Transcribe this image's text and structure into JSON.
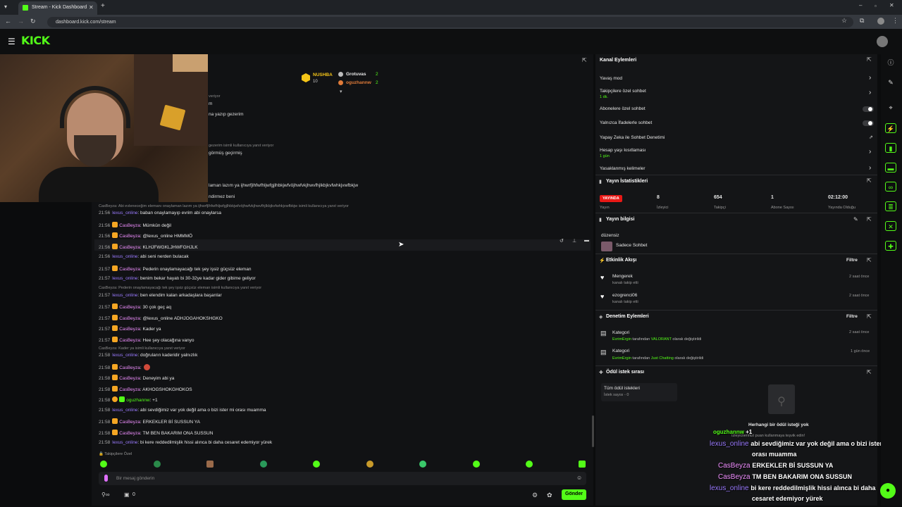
{
  "browser": {
    "tab_title": "Stream - Kick Dashboard",
    "url": "dashboard.kick.com/stream"
  },
  "kick": {
    "logo": "KICK"
  },
  "leaderboard": {
    "first_name": "NUSHBA",
    "first_score": "10",
    "second_name": "Grotuvas",
    "second_score": "2",
    "third_name": "oguzhannw",
    "third_score": "2"
  },
  "chat_fragments": [
    "veriyor",
    "m",
    "na yazıp gezerim",
    "gezerim isimli kullanıcıya yanıt veriyor",
    "görmüş geçirmiş",
    "laman lazım ya ijhwrfjlhfwfhljwfgjlhbkjwfvöjhwfvkjhwvfhjlkbjkvfwhkjvwfbkjw",
    "ndirmez beni"
  ],
  "chat": [
    {
      "reply": "CasBeyza: Abi evleneceğim elemanı onaylaman lazım ya ijhwrfjlhfwfhljwfgjlhbkjwfvöjhwfvkjhwvfhjlkbjkvfwhkjvwfbkjw isimli kullanıcıya yanıt veriyor"
    },
    {
      "time": "21:56",
      "user": "lexus_online",
      "cls": "uo",
      "text": ": baban onaylamayıp evrim abi onaylarsa"
    },
    {
      "time": "21:56",
      "user": "CasBeyza",
      "cls": "uc",
      "text": ": Mümkün değil"
    },
    {
      "time": "21:56",
      "user": "CasBeyza",
      "cls": "uc",
      "text": ": @lexus_online HMMMÖ"
    },
    {
      "time": "21:56",
      "user": "CasBeyza",
      "cls": "uc",
      "text": ": KLHJFWGKLJHWFGHJLK"
    },
    {
      "time": "21:56",
      "user": "lexus_online",
      "cls": "uo",
      "text": ": abi seni nerden bulacak"
    },
    {
      "time": "21:57",
      "user": "CasBeyza",
      "cls": "uc",
      "text": ": Pederin onaylamayacağı tek şey işsiz güçsüz eleman"
    },
    {
      "time": "21:57",
      "user": "lexus_online",
      "cls": "uo",
      "text": ": benim bekar hayatı bi 30-32ye kadar gider gibime geliyor"
    },
    {
      "reply": "CasBeyza: Pederin onaylamayacağı tek şey işsiz güçsüz eleman isimli kullanıcıya yanıt veriyor"
    },
    {
      "time": "21:57",
      "user": "lexus_online",
      "cls": "uo",
      "text": ": ben elendim kalan arkadaşlara başarılar"
    },
    {
      "time": "21:57",
      "user": "CasBeyza",
      "cls": "uc",
      "text": ": 30 çok geç aq"
    },
    {
      "time": "21:57",
      "user": "CasBeyza",
      "cls": "uc",
      "text": ": @lexus_online ADHJOGAHOKSHGKO"
    },
    {
      "time": "21:57",
      "user": "CasBeyza",
      "cls": "uc",
      "text": ": Kader ya"
    },
    {
      "time": "21:57",
      "user": "CasBeyza",
      "cls": "uc",
      "text": ": Hee şey olacağına vanyo"
    },
    {
      "reply": "CasBeyza: Kader ya isimli kullanıcıya yanıt veriyor"
    },
    {
      "time": "21:58",
      "user": "lexus_online",
      "cls": "uo",
      "text": ": doğruların kaderidir yalnızlık"
    },
    {
      "time": "21:58",
      "user": "CasBeyza",
      "cls": "uc",
      "text": ":"
    },
    {
      "time": "21:58",
      "user": "CasBeyza",
      "cls": "uc",
      "text": ": Deneyim abi ya"
    },
    {
      "time": "21:58",
      "user": "CasBeyza",
      "cls": "uc",
      "text": ": AKHOGSHOKGHOKOS"
    },
    {
      "time": "21:58",
      "user": "oguzhannw",
      "cls": "ug",
      "text": ": +1"
    },
    {
      "time": "21:58",
      "user": "lexus_online",
      "cls": "uo",
      "text": ": abi sevdiğimiz var yok değil ama o bizi ister mi orası muamma"
    },
    {
      "time": "21:58",
      "user": "CasBeyza",
      "cls": "uc",
      "text": ": ERKEKLER Bİ SUSSUN YA"
    },
    {
      "time": "21:58",
      "user": "CasBeyza",
      "cls": "uc",
      "text": ": TM BEN BAKARIM ONA SUSSUN"
    },
    {
      "time": "21:58",
      "user": "lexus_online",
      "cls": "uo",
      "text": ": bi kere reddedilmişlik hissi alınca bi daha cesaret edemiyor yürek"
    }
  ],
  "chat_footer": {
    "followers_only": "Takipçilere Özel",
    "input_placeholder": "Bir mesaj gönderin",
    "send_label": "Gönder",
    "points": "0"
  },
  "channel_actions": {
    "title": "Kanal Eylemleri",
    "slow_mode": "Yavaş mod",
    "followers_only": "Takipçilere özel sohbet",
    "followers_only_sub": "1 dk.",
    "subs_only": "Abonelere özel sohbet",
    "emotes_only": "Yalnızca İfadelerle sohbet",
    "ai_moderation": "Yapay Zeka ile Sohbet Denetimi",
    "age_restriction": "Hesap yaşı kısıtlaması",
    "age_restriction_sub": "1 gün",
    "banned_words": "Yasaklanmış kelimeler"
  },
  "stream_stats": {
    "title": "Yayın İstatistikleri",
    "live": "YAYINDA",
    "live_sub": "Yayın",
    "viewers": "8",
    "viewers_label": "İzleyici",
    "followers": "654",
    "followers_label": "Takipçi",
    "subs": "1",
    "subs_label": "Abone Sayısı",
    "uptime": "02:12:00",
    "uptime_label": "Yayında Olduğu"
  },
  "stream_info": {
    "title": "Yayın bilgisi",
    "stream_title": "düzensiz",
    "category": "Sadece Sohbet"
  },
  "activity": {
    "title": "Etkinlik Akışı",
    "filter": "Filtre",
    "items": [
      {
        "user": "Mengerek",
        "action": "kanalı takip etti",
        "time": "2 saat önce"
      },
      {
        "user": "ezogrenci06",
        "action": "kanalı takip etti",
        "time": "2 saat önce"
      }
    ]
  },
  "mod_actions": {
    "title": "Denetim Eylemleri",
    "filter": "Filtre",
    "items": [
      {
        "label": "Kategori",
        "by": "EvrimErgin",
        "mid": " tarafından ",
        "value": "VALORANT",
        "end": " olarak değiştirildi",
        "time": "2 saat önce"
      },
      {
        "label": "Kategori",
        "by": "EvrimErgin",
        "mid": " tarafından ",
        "value": "Just Chatting",
        "end": " olarak değiştirildi",
        "time": "1 gün önce"
      }
    ]
  },
  "rewards": {
    "title": "Ödül istek sırası",
    "all_requests": "Tüm ödül istekleri",
    "requests_count": "İstek sayısı - 0",
    "empty_title": "Herhangi bir ödül isteği yok",
    "empty_sub": "İzleyicilerinizi puan kullanmaya teşvik edin!"
  },
  "overlay_chat": [
    {
      "user": "oguzhannw",
      "text": "+1",
      "color": "#53fc18"
    },
    {
      "user": "lexus_online",
      "text": "abi sevdiğimiz var yok değil ama o bizi ister mi",
      "color": "#9b7bff"
    },
    {
      "user": "",
      "text": "orası muamma",
      "color": "#9b7bff"
    },
    {
      "user": "CasBeyza",
      "text": "ERKEKLER Bİ SUSSUN YA",
      "color": "#f08fff"
    },
    {
      "user": "CasBeyza",
      "text": "TM BEN BAKARIM ONA SUSSUN",
      "color": "#f08fff"
    },
    {
      "user": "lexus_online",
      "text": "bi kere reddedilmişlik hissi alınca bi daha",
      "color": "#9b7bff"
    },
    {
      "user": "",
      "text": "cesaret edemiyor yürek",
      "color": "#9b7bff"
    }
  ],
  "colors": {
    "accent": "#53fc18",
    "live": "#e91916"
  }
}
